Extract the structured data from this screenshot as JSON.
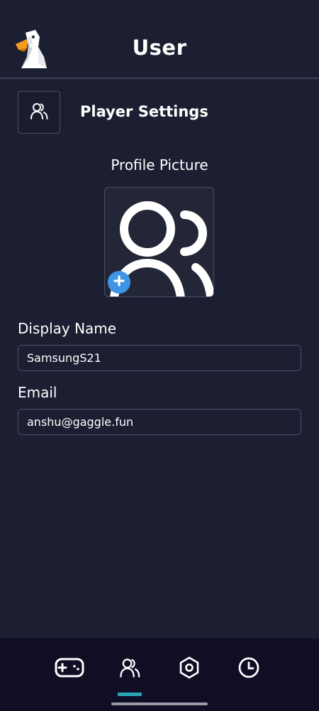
{
  "header": {
    "title": "User",
    "logo_icon": "goose-logo-icon"
  },
  "section": {
    "icon": "users-icon",
    "title": "Player Settings"
  },
  "profile": {
    "label": "Profile Picture",
    "avatar_icon": "users-icon",
    "add_icon": "plus-icon",
    "add_color": "#3f94e4"
  },
  "form": {
    "display_name_label": "Display Name",
    "display_name_value": "SamsungS21",
    "email_label": "Email",
    "email_value": "anshu@gaggle.fun"
  },
  "nav": {
    "items": [
      {
        "icon": "gamepad-icon",
        "active": false
      },
      {
        "icon": "users-icon",
        "active": true
      },
      {
        "icon": "hex-settings-icon",
        "active": false
      },
      {
        "icon": "clock-icon",
        "active": false
      }
    ],
    "active_color": "#2aa6b4"
  },
  "colors": {
    "background": "#1c1f32",
    "nav_background": "#0f0e24",
    "border": "#4a4f66"
  }
}
